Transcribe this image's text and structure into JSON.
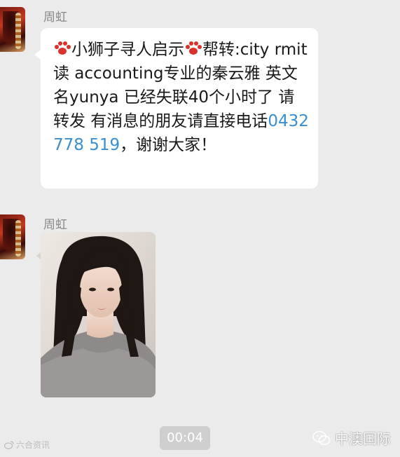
{
  "messages": [
    {
      "sender": "周虹",
      "segments": {
        "line_a": "小狮子寻人启示",
        "line_b": "帮转:city rmit读 accounting专业的秦云雅 英文名yunya 已经失联40个小时了 请转发 有消息的朋友请直接电话",
        "phone": "0432 778 519",
        "line_c": "，谢谢大家！"
      },
      "icons": [
        "paw-print-icon",
        "paw-print-icon"
      ]
    },
    {
      "sender": "周虹",
      "image": "photo-of-young-woman-with-long-dark-hair"
    }
  ],
  "video_timestamp": "00:04",
  "watermark_left": "六合资讯",
  "watermark_right": "中澳国际",
  "colors": {
    "background": "#ebebeb",
    "bubble": "#ffffff",
    "link": "#3a8fd0",
    "sender": "#888888"
  }
}
